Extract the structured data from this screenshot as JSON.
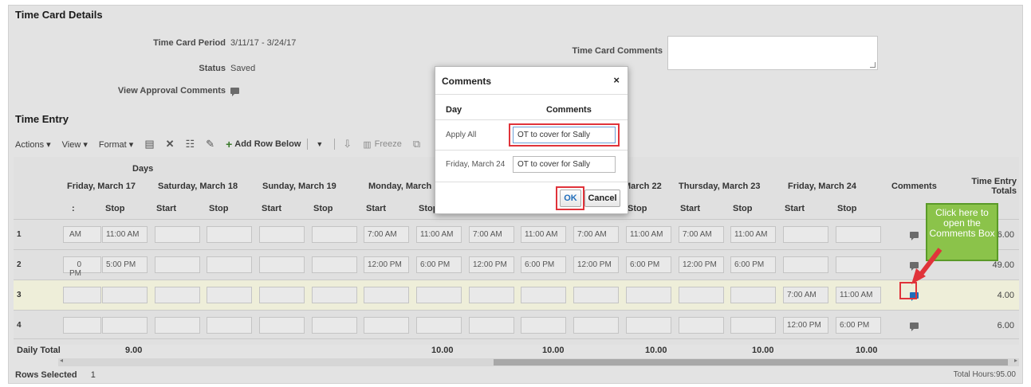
{
  "sections": {
    "details_title": "Time Card Details",
    "entry_title": "Time Entry"
  },
  "details": {
    "period_label": "Time Card Period",
    "period_value": "3/11/17 - 3/24/17",
    "status_label": "Status",
    "status_value": "Saved",
    "approval_label": "View Approval Comments",
    "comments_label": "Time Card Comments",
    "comments_value": ""
  },
  "toolbar": {
    "actions": "Actions ▾",
    "view": "View ▾",
    "format": "Format ▾",
    "add_row": "Add Row Below",
    "freeze": "Freeze"
  },
  "grid": {
    "days_header": "Days",
    "day_headers": [
      "Friday, March 17",
      "Saturday, March 18",
      "Sunday, March 19",
      "Monday, March",
      "March 22",
      "Thursday, March 23",
      "Friday, March 24"
    ],
    "start": "Start",
    "stop": "Stop",
    "comments_header": "Comments",
    "totals_header_1": "Time Entry",
    "totals_header_2": "Totals",
    "rows": [
      {
        "num": "1",
        "cells": [
          "AM",
          "11:00 AM",
          "",
          "",
          "",
          "",
          "7:00 AM",
          "11:00 AM",
          "7:00 AM",
          "11:00 AM",
          "7:00 AM",
          "11:00 AM",
          "7:00 AM",
          "11:00 AM",
          "",
          ""
        ],
        "total": "36.00"
      },
      {
        "num": "2",
        "cells": [
          "0 PM",
          "5:00 PM",
          "",
          "",
          "",
          "",
          "12:00 PM",
          "6:00 PM",
          "12:00 PM",
          "6:00 PM",
          "12:00 PM",
          "6:00 PM",
          "12:00 PM",
          "6:00 PM",
          "",
          ""
        ],
        "total": "49.00"
      },
      {
        "num": "3",
        "cells": [
          "",
          "",
          "",
          "",
          "",
          "",
          "",
          "",
          "",
          "",
          "",
          "",
          "",
          "",
          "7:00 AM",
          "11:00 AM"
        ],
        "total": "4.00"
      },
      {
        "num": "4",
        "cells": [
          "",
          "",
          "",
          "",
          "",
          "",
          "",
          "",
          "",
          "",
          "",
          "",
          "",
          "",
          "12:00 PM",
          "6:00 PM"
        ],
        "total": "6.00"
      }
    ],
    "daily_total_label": "Daily Total",
    "daily_totals": [
      "9.00",
      "10.00",
      "10.00",
      "10.00",
      "10.00",
      "10.00"
    ]
  },
  "footer": {
    "rows_selected_label": "Rows Selected",
    "rows_selected_value": "1",
    "total_hours": "Total Hours:95.00"
  },
  "dialog": {
    "title": "Comments",
    "close": "×",
    "col_day": "Day",
    "col_comments": "Comments",
    "rows": [
      {
        "day": "Apply All",
        "comment": "OT to cover for Sally"
      },
      {
        "day": "Friday, March 24",
        "comment": "OT to cover for Sally"
      }
    ],
    "ok": "OK",
    "cancel": "Cancel"
  },
  "callout": {
    "text": "Click here to open the Comments Box"
  },
  "colors": {
    "highlight_red": "#e0333a",
    "callout_green": "#8bc34a",
    "icon_blue": "#1f6dbb"
  }
}
